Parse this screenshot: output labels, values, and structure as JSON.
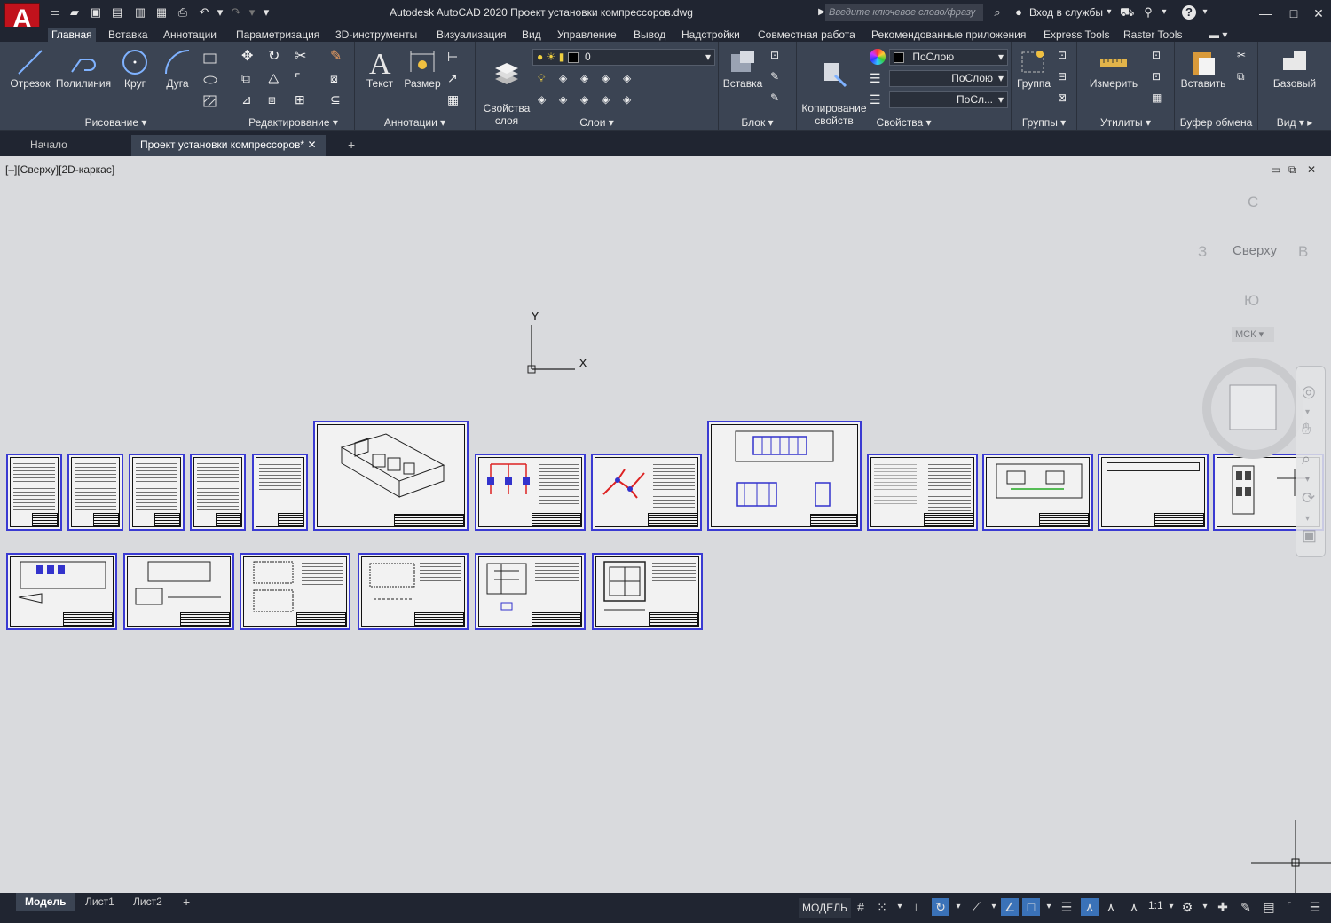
{
  "app": {
    "logo_letter": "A",
    "title": "Autodesk AutoCAD 2020   Проект установки компрессоров.dwg",
    "search_placeholder": "Введите ключевое слово/фразу",
    "signin": "Вход в службы",
    "help": "?"
  },
  "menu": [
    "Главная",
    "Вставка",
    "Аннотации",
    "Параметризация",
    "3D-инструменты",
    "Визуализация",
    "Вид",
    "Управление",
    "Вывод",
    "Надстройки",
    "Совместная работа",
    "Рекомендованные приложения",
    "Express Tools",
    "Raster Tools"
  ],
  "ribbon": {
    "draw": {
      "title": "Рисование",
      "line": "Отрезок",
      "polyline": "Полилиния",
      "circle": "Круг",
      "arc": "Дуга"
    },
    "modify": {
      "title": "Редактирование"
    },
    "annotation": {
      "title": "Аннотации",
      "text": "Текст",
      "dimension": "Размер"
    },
    "layers": {
      "title": "Слои",
      "properties": "Свойства\nслоя",
      "current_layer": "0"
    },
    "block": {
      "title": "Блок",
      "insert": "Вставка"
    },
    "properties": {
      "title": "Свойства",
      "match": "Копирование\nсвойств",
      "color": "ПоСлою",
      "linetype": "ПоСлою",
      "lineweight": "ПоСл..."
    },
    "groups": {
      "title": "Группы",
      "group": "Группа"
    },
    "utilities": {
      "title": "Утилиты",
      "measure": "Измерить"
    },
    "clipboard": {
      "title": "Буфер обмена",
      "paste": "Вставить"
    },
    "view": {
      "title": "Вид",
      "base": "Базовый"
    }
  },
  "doc_tabs": {
    "start": "Начало",
    "drawing": "Проект установки компрессоров*"
  },
  "viewport": {
    "label": "[–][Сверху][2D-каркас]",
    "ucs_x": "X",
    "ucs_y": "Y",
    "navcube": {
      "top": "Сверху",
      "north": "С",
      "south": "Ю",
      "west": "З",
      "east": "В",
      "wcs": "МСК"
    }
  },
  "layout_tabs": [
    "Модель",
    "Лист1",
    "Лист2"
  ],
  "status": {
    "model": "МОДЕЛЬ",
    "scale": "1:1"
  },
  "colors": {
    "accent": "#3a3ad2",
    "ribbon_bg": "#3b4453",
    "title_bg": "#202531",
    "canvas": "#d9dadd"
  }
}
